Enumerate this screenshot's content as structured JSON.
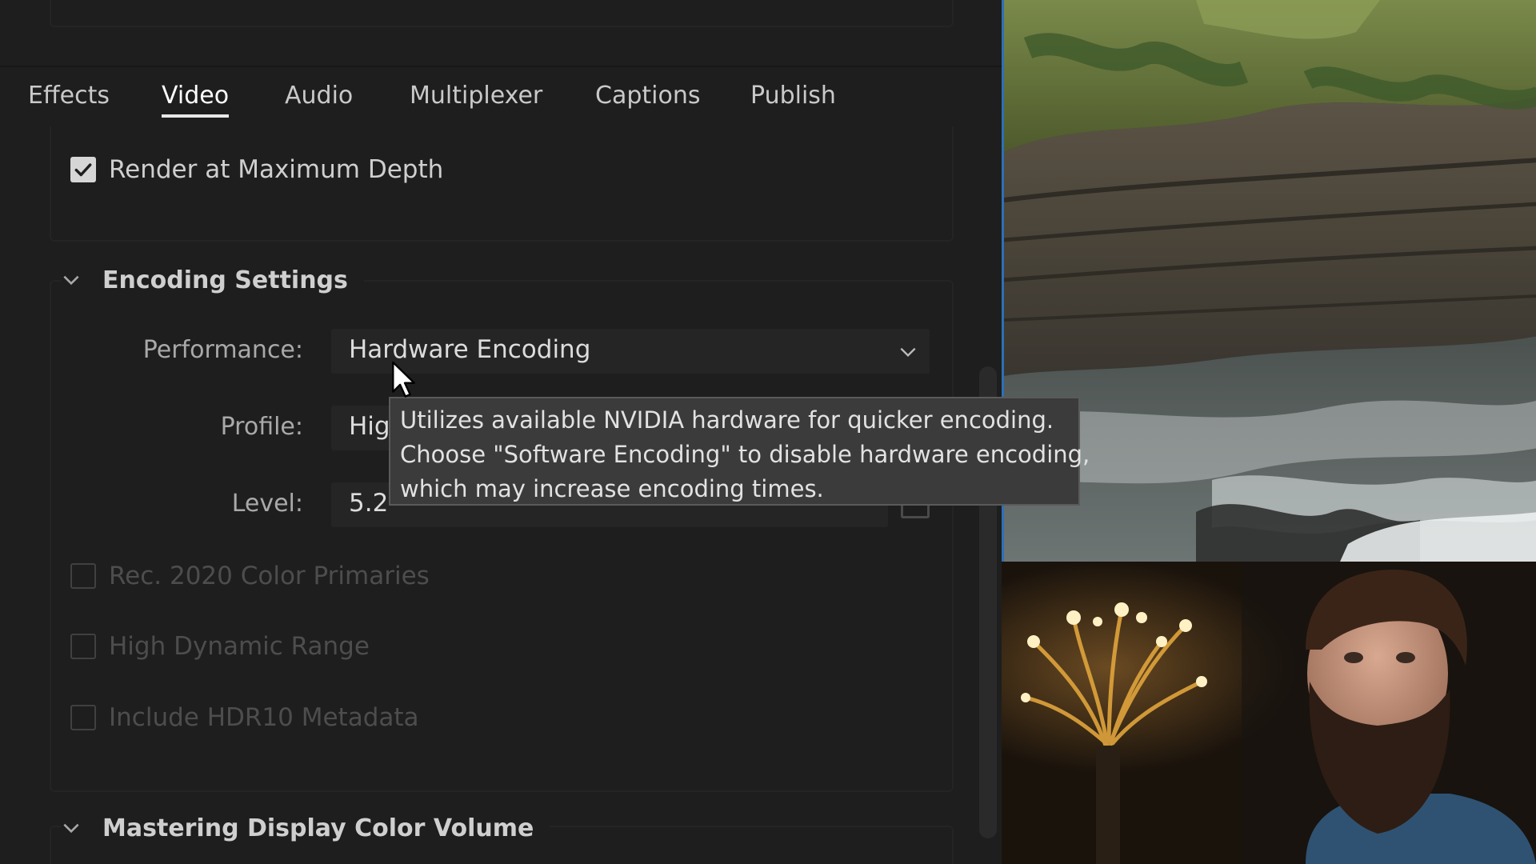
{
  "tabs": [
    {
      "label": "Effects"
    },
    {
      "label": "Video"
    },
    {
      "label": "Audio"
    },
    {
      "label": "Multiplexer"
    },
    {
      "label": "Captions"
    },
    {
      "label": "Publish"
    }
  ],
  "active_tab": "Video",
  "video": {
    "render_max_depth": {
      "label": "Render at Maximum Depth",
      "checked": true
    }
  },
  "encoding": {
    "title": "Encoding Settings",
    "performance": {
      "label": "Performance:",
      "value": "Hardware Encoding"
    },
    "profile": {
      "label": "Profile:",
      "value": "Hig"
    },
    "level": {
      "label": "Level:",
      "value": "5.2"
    },
    "rec2020": {
      "label": "Rec. 2020 Color Primaries",
      "checked": false,
      "enabled": false
    },
    "hdr": {
      "label": "High Dynamic Range",
      "checked": false,
      "enabled": false
    },
    "hdr10": {
      "label": "Include HDR10 Metadata",
      "checked": false,
      "enabled": false
    }
  },
  "mastering": {
    "title": "Mastering Display Color Volume"
  },
  "tooltip": {
    "line1": "Utilizes available NVIDIA hardware for quicker encoding.",
    "line2": "Choose \"Software Encoding\" to disable hardware encoding,",
    "line3": "which may increase encoding times."
  },
  "icons": {
    "checkbox_check": "checkmark-icon",
    "section_toggle": "chevron-down-icon",
    "dropdown_arrow": "chevron-down-icon",
    "cursor": "mouse-pointer-icon"
  },
  "colors": {
    "panel_bg": "#1e1e1e",
    "tooltip_bg": "#3b3b3b",
    "accent_divider": "#2d6fb6"
  }
}
